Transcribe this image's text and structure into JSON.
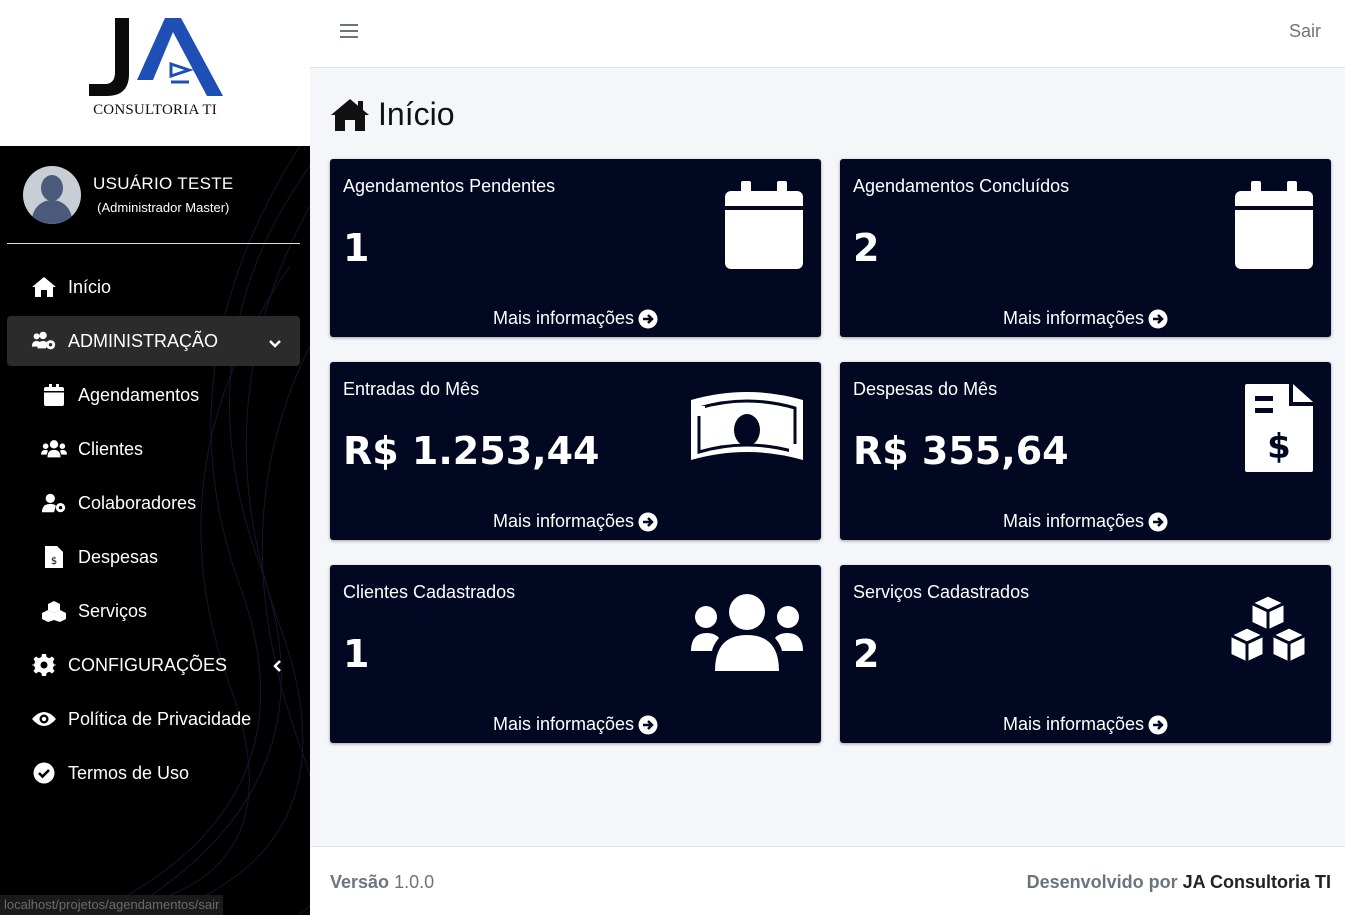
{
  "brand": {
    "logo_letters": "JA",
    "subtitle": "CONSULTORIA TI"
  },
  "user": {
    "name": "USUÁRIO TESTE",
    "role": "(Administrador Master)"
  },
  "nav": {
    "inicio": "Início",
    "administracao": "ADMINISTRAÇÃO",
    "agendamentos": "Agendamentos",
    "clientes": "Clientes",
    "colaboradores": "Colaboradores",
    "despesas": "Despesas",
    "servicos": "Serviços",
    "configuracoes": "CONFIGURAÇÕES",
    "privacidade": "Política de Privacidade",
    "termos": "Termos de Uso"
  },
  "status_url": "localhost/projetos/agendamentos/sair",
  "topbar": {
    "logout": "Sair"
  },
  "page": {
    "title": "Início"
  },
  "cards": [
    {
      "title": "Agendamentos Pendentes",
      "value": "1",
      "link": "Mais informações",
      "icon": "calendar-icon"
    },
    {
      "title": "Agendamentos Concluídos",
      "value": "2",
      "link": "Mais informações",
      "icon": "calendar-icon"
    },
    {
      "title": "Entradas do Mês",
      "value": "R$ 1.253,44",
      "link": "Mais informações",
      "icon": "money-bill-icon"
    },
    {
      "title": "Despesas do Mês",
      "value": "R$ 355,64",
      "link": "Mais informações",
      "icon": "invoice-dollar-icon"
    },
    {
      "title": "Clientes Cadastrados",
      "value": "1",
      "link": "Mais informações",
      "icon": "users-icon"
    },
    {
      "title": "Serviços Cadastrados",
      "value": "2",
      "link": "Mais informações",
      "icon": "cubes-icon"
    }
  ],
  "footer": {
    "version_label": "Versão",
    "version_value": "1.0.0",
    "developed_by": "Desenvolvido por",
    "developer": "JA Consultoria TI"
  },
  "colors": {
    "sidebar": "#000000",
    "card": "#030822",
    "brand_blue": "#1e4fb4",
    "content_bg": "#f4f6f9"
  }
}
